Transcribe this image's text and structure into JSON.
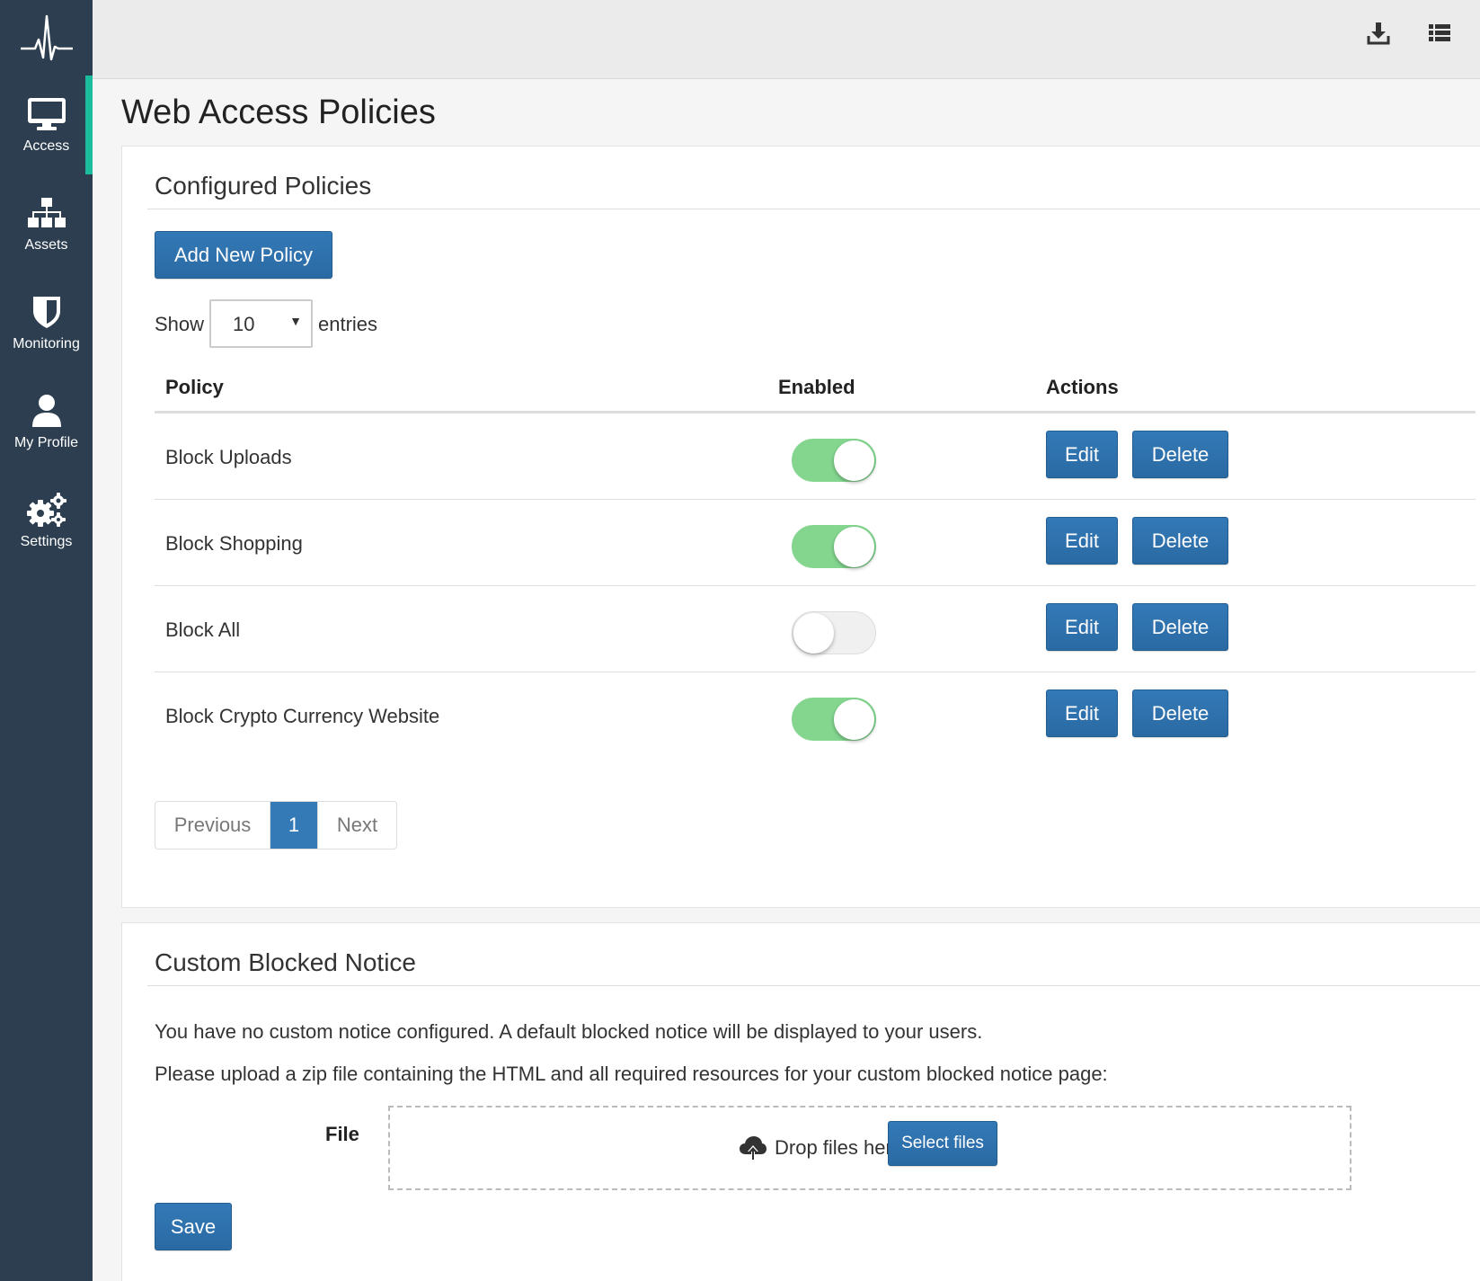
{
  "sidebar": {
    "items": [
      {
        "label": "Access",
        "icon": "monitor-icon",
        "active": true
      },
      {
        "label": "Assets",
        "icon": "sitemap-icon",
        "active": false
      },
      {
        "label": "Monitoring",
        "icon": "shield-icon",
        "active": false
      },
      {
        "label": "My Profile",
        "icon": "user-icon",
        "active": false
      },
      {
        "label": "Settings",
        "icon": "gears-icon",
        "active": false
      }
    ]
  },
  "topbar": {
    "icons": [
      "download-icon",
      "list-icon"
    ]
  },
  "page": {
    "title": "Web Access Policies"
  },
  "policies_panel": {
    "heading": "Configured Policies",
    "add_button": "Add New Policy",
    "show_label": "Show",
    "entries_value": "10",
    "entries_label": "entries",
    "columns": {
      "policy": "Policy",
      "enabled": "Enabled",
      "actions": "Actions"
    },
    "rows": [
      {
        "name": "Block Uploads",
        "enabled": true,
        "edit": "Edit",
        "delete": "Delete"
      },
      {
        "name": "Block Shopping",
        "enabled": true,
        "edit": "Edit",
        "delete": "Delete"
      },
      {
        "name": "Block All",
        "enabled": false,
        "edit": "Edit",
        "delete": "Delete"
      },
      {
        "name": "Block Crypto Currency Website",
        "enabled": true,
        "edit": "Edit",
        "delete": "Delete"
      }
    ],
    "pagination": {
      "previous": "Previous",
      "current": "1",
      "next": "Next"
    }
  },
  "notice_panel": {
    "heading": "Custom Blocked Notice",
    "message1": "You have no custom notice configured. A default blocked notice will be displayed to your users.",
    "message2": "Please upload a zip file containing the HTML and all required resources for your custom blocked notice page:",
    "file_label": "File",
    "drop_text": "Drop files here or",
    "select_button": "Select files",
    "save_button": "Save"
  },
  "colors": {
    "sidebar": "#2c3e50",
    "accent": "#1abc9c",
    "primary": "#337ab7",
    "toggle_on": "#84d68f"
  }
}
